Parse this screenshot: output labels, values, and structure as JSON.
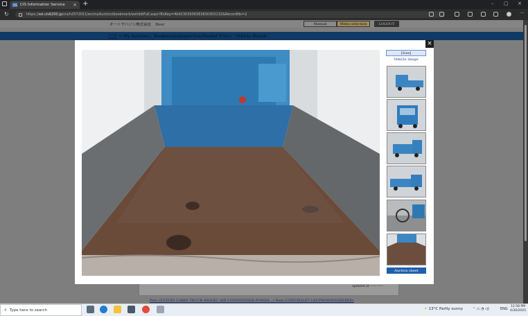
{
  "browser": {
    "tab_title": "CIS Information Service",
    "favicon_text": "CIS",
    "url_host": "ssl.cis6200.jp",
    "url_path": "/cis/h2572011/en/myAuction/bookmark/exhibitFull.aspx?ExKey=4b4230393636383030313​2&RecordNo=2",
    "url_full": "https://ssl.cis6200.jp/cis/h2572011/en/myAuction/bookmark/exhibitFull.aspx?ExKey=4b42303936363830303132&RecordNo=2"
  },
  "header": {
    "company": "オートサハジン株式会社",
    "user": "Beer",
    "buttons": [
      "Manual",
      "Menu selection",
      "LOGOUT"
    ]
  },
  "breadcrumb": {
    "top": "TOP",
    "path": "> My Auctions｜Bookmarks(Inspection/Market Price)｜Vehicle Details｜"
  },
  "modal": {
    "size_button": "[Size]",
    "side_label": "Vehicle image",
    "auction_sheet": "Auction sheet",
    "close": "×"
  },
  "background": {
    "updated_text": "updated at ------ ------",
    "prevnext": "Prev (SUZUKI CARRY TRUCK 4WD/KC AIR CONDITIONER POWER...) Next (CHEVROLET LAT/PROWEDISHERED)"
  },
  "taskbar": {
    "search_placeholder": "Type here to search",
    "weather": "13°C  Partly sunny",
    "lang": "ENG",
    "time": "12:58 PM",
    "date": "4/30/2025"
  }
}
